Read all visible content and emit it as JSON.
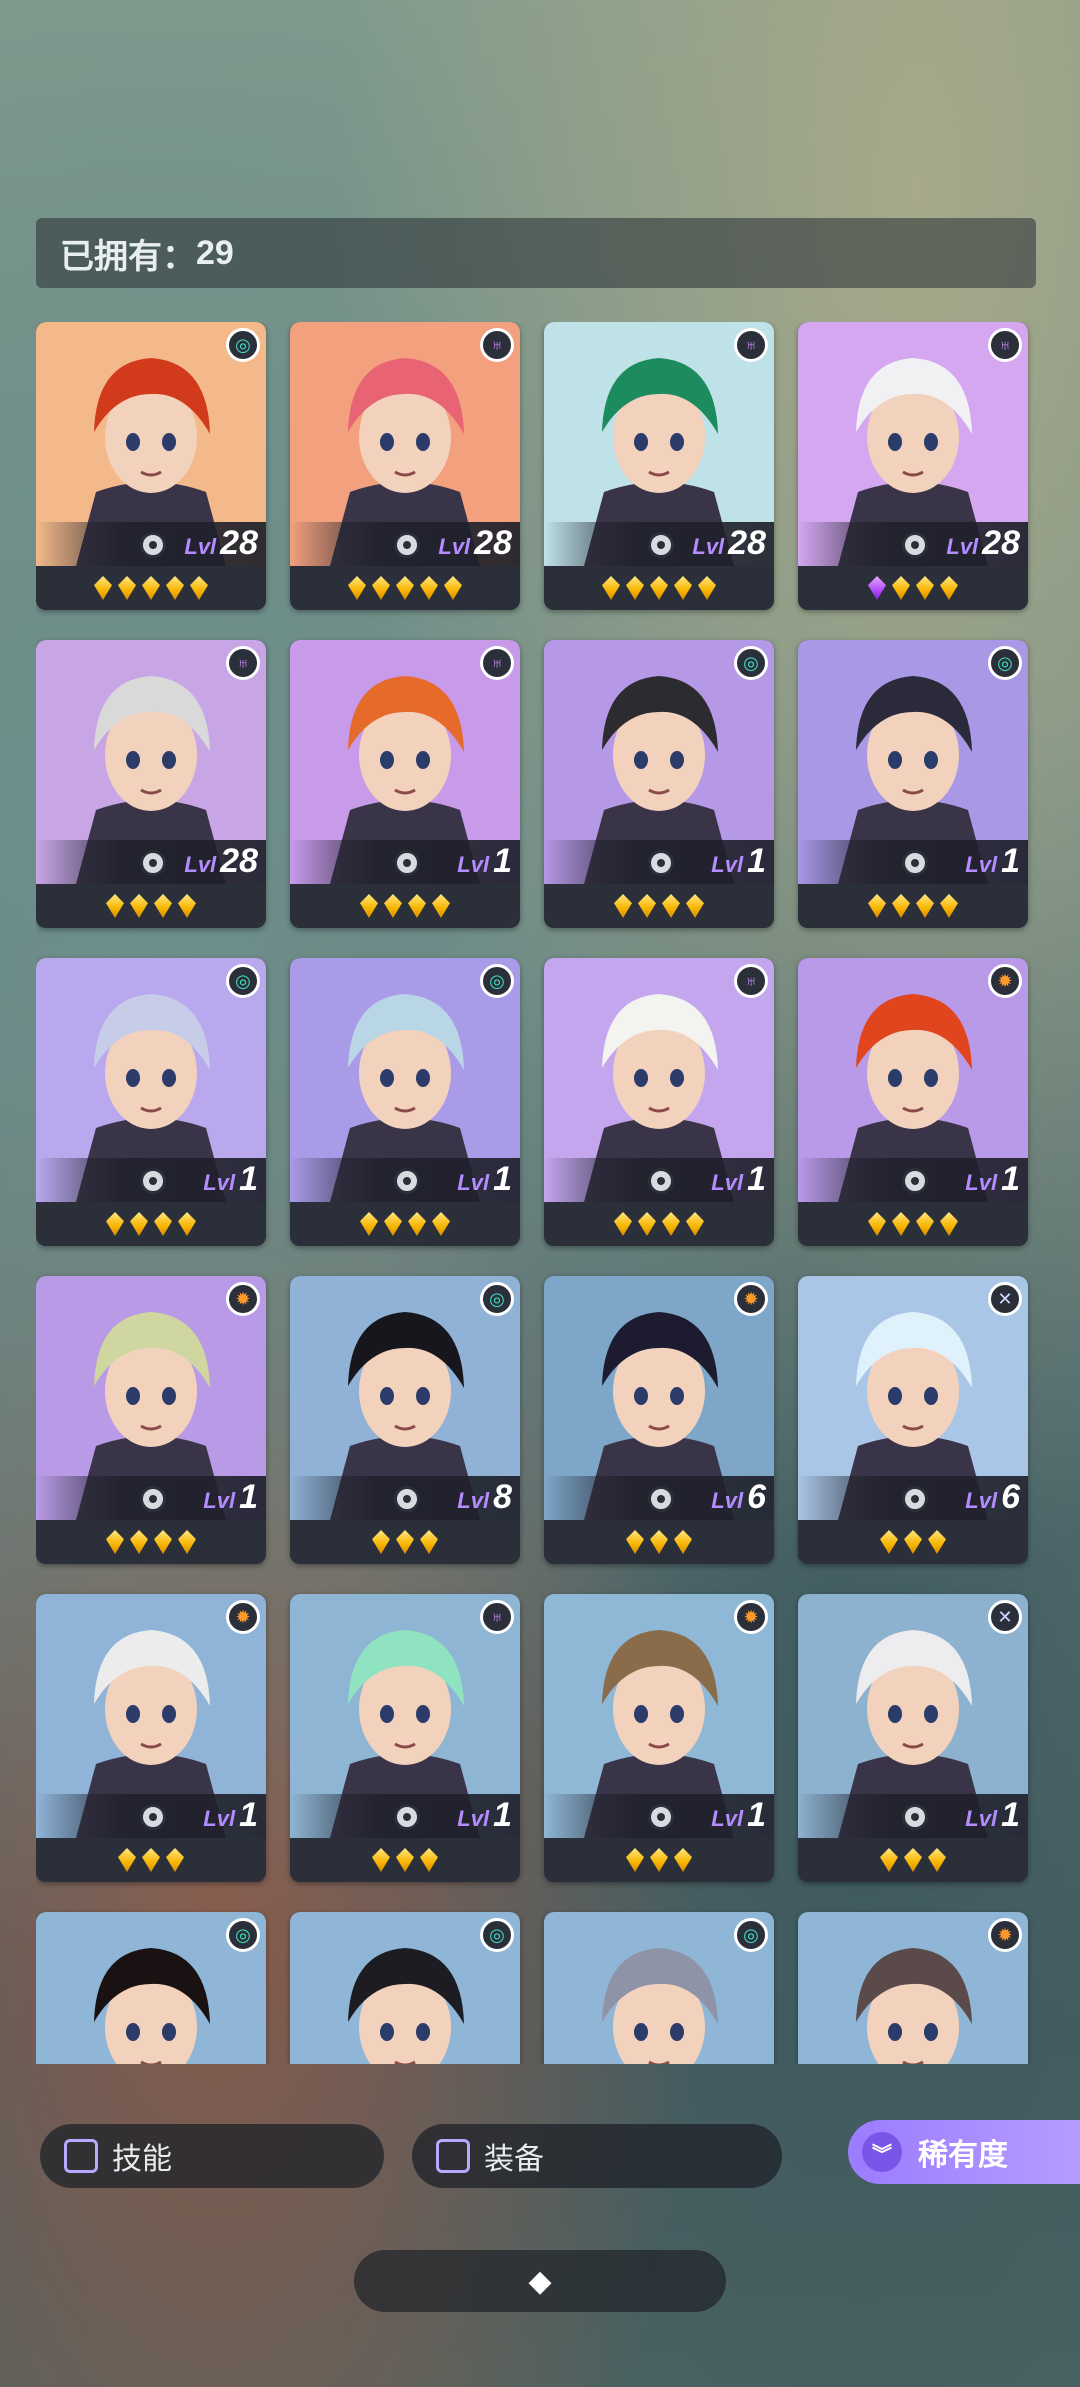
{
  "owned": {
    "label": "已拥有：",
    "count": "29"
  },
  "level_tag": "Lvl",
  "cards": [
    {
      "level": "28",
      "stars": [
        "gold",
        "gold",
        "gold",
        "gold",
        "gold"
      ],
      "faction": "teal",
      "bg": "#f4b98a",
      "hair": "#d23a1c"
    },
    {
      "level": "28",
      "stars": [
        "gold",
        "gold",
        "gold",
        "gold",
        "gold"
      ],
      "faction": "purple",
      "bg": "#f2a07e",
      "hair": "#e86474"
    },
    {
      "level": "28",
      "stars": [
        "gold",
        "gold",
        "gold",
        "gold",
        "gold"
      ],
      "faction": "purple",
      "bg": "#bfe2e8",
      "hair": "#1c8c5e"
    },
    {
      "level": "28",
      "stars": [
        "purple",
        "gold",
        "gold",
        "gold"
      ],
      "faction": "purple",
      "bg": "#d4a7f0",
      "hair": "#f1f1f4"
    },
    {
      "level": "28",
      "stars": [
        "gold",
        "gold",
        "gold",
        "gold"
      ],
      "faction": "purple",
      "bg": "#c8a6e6",
      "hair": "#d9d9d9"
    },
    {
      "level": "1",
      "stars": [
        "gold",
        "gold",
        "gold",
        "gold"
      ],
      "faction": "purple",
      "bg": "#c79bea",
      "hair": "#e66a2a"
    },
    {
      "level": "1",
      "stars": [
        "gold",
        "gold",
        "gold",
        "gold"
      ],
      "faction": "teal",
      "bg": "#b598e6",
      "hair": "#2c2c30"
    },
    {
      "level": "1",
      "stars": [
        "gold",
        "gold",
        "gold",
        "gold"
      ],
      "faction": "teal",
      "bg": "#a898e6",
      "hair": "#2a2a3a"
    },
    {
      "level": "1",
      "stars": [
        "gold",
        "gold",
        "gold",
        "gold"
      ],
      "faction": "teal",
      "bg": "#b9a8ee",
      "hair": "#c7cde8"
    },
    {
      "level": "1",
      "stars": [
        "gold",
        "gold",
        "gold",
        "gold"
      ],
      "faction": "teal",
      "bg": "#a99be8",
      "hair": "#b8d6e6"
    },
    {
      "level": "1",
      "stars": [
        "gold",
        "gold",
        "gold",
        "gold"
      ],
      "faction": "purple",
      "bg": "#c3a6ee",
      "hair": "#f3f3f0"
    },
    {
      "level": "1",
      "stars": [
        "gold",
        "gold",
        "gold",
        "gold"
      ],
      "faction": "orange",
      "bg": "#b99ae8",
      "hair": "#e0451e"
    },
    {
      "level": "1",
      "stars": [
        "gold",
        "gold",
        "gold",
        "gold"
      ],
      "faction": "orange",
      "bg": "#b89ae6",
      "hair": "#cfd6a0"
    },
    {
      "level": "8",
      "stars": [
        "gold",
        "gold",
        "gold"
      ],
      "faction": "teal",
      "bg": "#8fb2d6",
      "hair": "#16161c"
    },
    {
      "level": "6",
      "stars": [
        "gold",
        "gold",
        "gold"
      ],
      "faction": "orange",
      "bg": "#7ea6c8",
      "hair": "#1c1b30"
    },
    {
      "level": "6",
      "stars": [
        "gold",
        "gold",
        "gold"
      ],
      "faction": "cross",
      "bg": "#a9c6e6",
      "hair": "#dff2fb"
    },
    {
      "level": "1",
      "stars": [
        "gold",
        "gold",
        "gold"
      ],
      "faction": "orange",
      "bg": "#8fb4d8",
      "hair": "#ececec"
    },
    {
      "level": "1",
      "stars": [
        "gold",
        "gold",
        "gold"
      ],
      "faction": "purple",
      "bg": "#8fb5d4",
      "hair": "#8fe3c0"
    },
    {
      "level": "1",
      "stars": [
        "gold",
        "gold",
        "gold"
      ],
      "faction": "orange",
      "bg": "#8fb7d6",
      "hair": "#8a6b4a"
    },
    {
      "level": "1",
      "stars": [
        "gold",
        "gold",
        "gold"
      ],
      "faction": "cross",
      "bg": "#8cb2cf",
      "hair": "#ededf0"
    },
    {
      "level": "",
      "stars": [],
      "faction": "teal",
      "bg": "#8fb6d6",
      "hair": "#1a1212"
    },
    {
      "level": "",
      "stars": [],
      "faction": "teal",
      "bg": "#8fb6d6",
      "hair": "#1c1c22"
    },
    {
      "level": "",
      "stars": [],
      "faction": "teal",
      "bg": "#8fb6d6",
      "hair": "#8f93a8"
    },
    {
      "level": "",
      "stars": [],
      "faction": "orange",
      "bg": "#8fb6d6",
      "hair": "#5a4a4a"
    }
  ],
  "filters": {
    "skill_label": "技能",
    "equip_label": "装备",
    "rarity_label": "稀有度"
  },
  "icons": {
    "rarity_icon": "double-chevron-down-icon",
    "handle_icon": "diamond-cluster-icon"
  }
}
